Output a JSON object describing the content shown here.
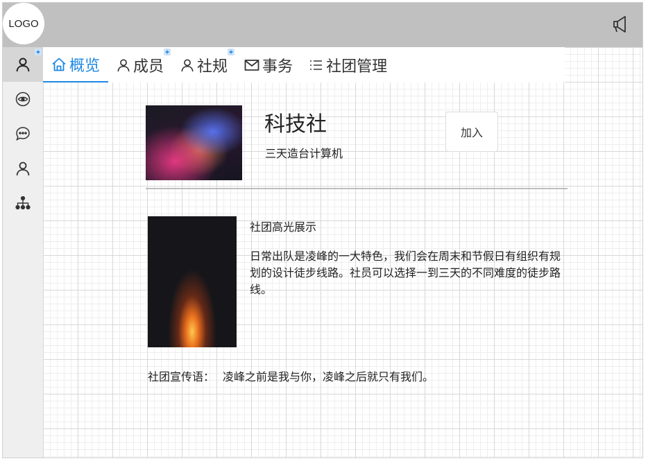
{
  "header": {
    "logo_text": "LOGO",
    "announce_icon": "megaphone-icon"
  },
  "sidebar": {
    "items": [
      {
        "icon": "user-icon",
        "active": true,
        "badge": true
      },
      {
        "icon": "eye-icon",
        "active": false,
        "badge": false
      },
      {
        "icon": "chat-icon",
        "active": false,
        "badge": false
      },
      {
        "icon": "user-icon",
        "active": false,
        "badge": false
      },
      {
        "icon": "org-tree-icon",
        "active": false,
        "badge": false
      }
    ]
  },
  "tabs": [
    {
      "label": "概览",
      "icon": "home-icon",
      "active": true,
      "badge": false
    },
    {
      "label": "成员",
      "icon": "user-icon",
      "active": false,
      "badge": true
    },
    {
      "label": "社规",
      "icon": "user-icon",
      "active": false,
      "badge": true
    },
    {
      "label": "事务",
      "icon": "mail-icon",
      "active": false,
      "badge": false
    },
    {
      "label": "社团管理",
      "icon": "list-icon",
      "active": false,
      "badge": false
    }
  ],
  "club": {
    "name": "科技社",
    "tagline": "三天造台计算机",
    "join_label": "加入",
    "highlight_title": "社团高光展示",
    "highlight_desc": "日常出队是凌峰的一大特色，我们会在周末和节假日有组织有规划的设计徒步线路。社员可以选择一到三天的不同难度的徒步路线。",
    "slogan_label": "社团宣传语：",
    "slogan": "凌峰之前是我与你，凌峰之后就只有我们。"
  },
  "colors": {
    "accent": "#1e88e5",
    "topbar": "#c0c0c0",
    "sidebar": "#efefef"
  }
}
